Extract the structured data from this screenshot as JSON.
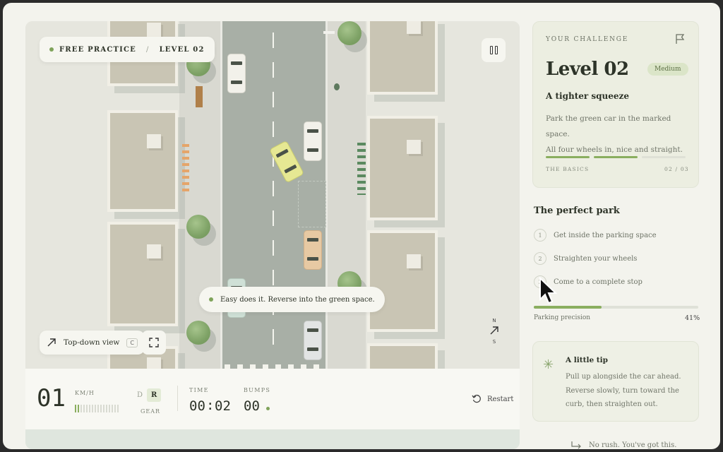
{
  "hud": {
    "mode": "FREE PRACTICE",
    "separator": "/",
    "level": "LEVEL 02",
    "hint": "Easy does it. Reverse into the green space.",
    "view_label": "Top-down view",
    "view_key": "C",
    "compass_n": "N",
    "compass_s": "S"
  },
  "dashboard": {
    "speed": "01",
    "speed_unit": "KM/H",
    "speed_level": 0.1,
    "gear_d": "D",
    "gear_r": "R",
    "gear_label": "GEAR",
    "time_label": "TIME",
    "time_min": "00",
    "time_sep": ":",
    "time_sec": "02",
    "bumps_label": "BUMPS",
    "bumps": "00",
    "restart": "Restart"
  },
  "challenge": {
    "eyebrow": "YOUR CHALLENGE",
    "title": "Level 02",
    "difficulty": "Medium",
    "subtitle": "A tighter squeeze",
    "desc_line1": "Park the green car in the marked space.",
    "desc_line2": "All four wheels in, nice and straight.",
    "section": "THE BASICS",
    "progress": "02 / 03"
  },
  "perfect_park": {
    "title": "The perfect park",
    "steps": [
      {
        "num": "1",
        "label": "Get inside the parking space"
      },
      {
        "num": "2",
        "label": "Straighten your wheels"
      },
      {
        "num": "3",
        "label": "Come to a complete stop"
      }
    ],
    "precision_label": "Parking precision",
    "precision_value": "41%",
    "precision_fraction": 0.41
  },
  "tip": {
    "title": "A little tip",
    "body": "Pull up alongside the car ahead. Reverse slowly, turn toward the curb, then straighten out."
  },
  "footer_note": "No rush. You've got this.",
  "colors": {
    "accent": "#8aae5f",
    "background": "#f3f3ed",
    "card": "#eceee1",
    "road": "#a8afa6",
    "player_car": "#e6e893"
  },
  "icons": [
    "flag-icon",
    "pause-icon",
    "arrow-view-icon",
    "fullscreen-icon",
    "compass-arrow-icon",
    "restart-icon",
    "sparkle-icon",
    "return-arrow-icon",
    "mouse-cursor-icon"
  ]
}
